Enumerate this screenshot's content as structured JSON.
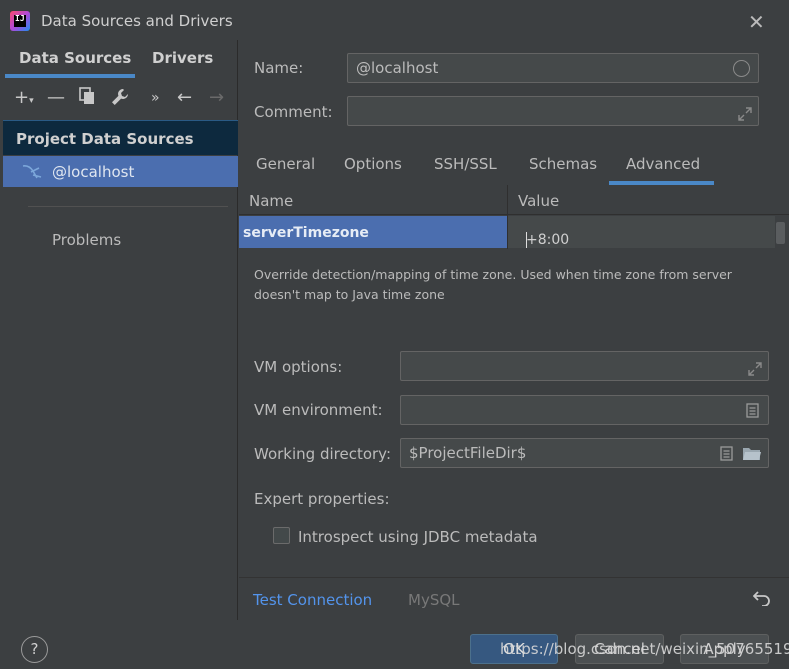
{
  "window": {
    "title": "Data Sources and Drivers",
    "app_icon_text": "IJ"
  },
  "left": {
    "tabs": [
      "Data Sources",
      "Drivers"
    ],
    "section_title": "Project Data Sources",
    "selected_item": "@localhost",
    "problems": "Problems"
  },
  "form": {
    "name_label": "Name:",
    "name_value": "@localhost",
    "comment_label": "Comment:",
    "comment_value": ""
  },
  "tabs": [
    "General",
    "Options",
    "SSH/SSL",
    "Schemas",
    "Advanced"
  ],
  "active_tab": "Advanced",
  "table": {
    "headers": [
      "Name",
      "Value"
    ],
    "selected_row": {
      "name": "serverTimezone",
      "value": "+8:00"
    }
  },
  "description": "Override detection/mapping of time zone. Used when time zone from server doesn't map to Java time zone",
  "vm": {
    "options_label": "VM options:",
    "options_value": "",
    "environment_label": "VM environment:",
    "environment_value": "",
    "workdir_label": "Working directory:",
    "workdir_value": "$ProjectFileDir$"
  },
  "expert": {
    "label": "Expert properties:",
    "introspect_label": "Introspect using JDBC metadata",
    "introspect_checked": false
  },
  "footer": {
    "test_connection": "Test Connection",
    "driver": "MySQL"
  },
  "buttons": {
    "help": "?",
    "ok": "OK",
    "cancel": "Cancel",
    "apply": "Apply"
  },
  "watermark": "https://blog.csdn.net/weixin_50765519",
  "colors": {
    "background": "#3c3f41",
    "selection": "#4b6eaf",
    "accent": "#4a88c7",
    "link": "#5394ec"
  }
}
